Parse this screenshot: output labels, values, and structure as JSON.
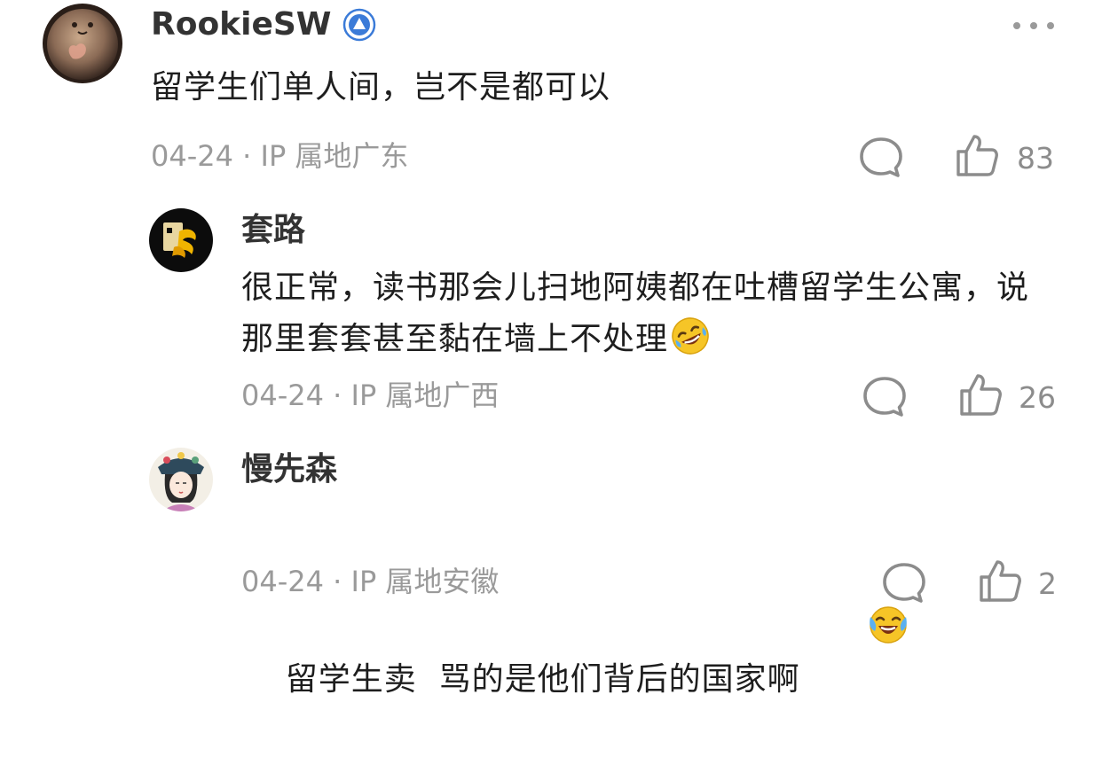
{
  "comments": [
    {
      "username": "RookieSW",
      "verified": true,
      "text": "留学生们单人间，岂不是都可以",
      "meta": "04-24 · IP 属地广东",
      "likes": "83"
    },
    {
      "username": "套路",
      "text": "很正常，读书那会儿扫地阿姨都在吐槽留学生公寓，说那里套套甚至黏在墙上不处理",
      "emoji": "rofl-emoji",
      "meta": "04-24 · IP 属地广西",
      "likes": "26"
    },
    {
      "username": "慢先森",
      "text": "留学生卖  骂的是他们背后的国家啊",
      "emoji": "laughing-crying-emoji",
      "meta": "04-24 · IP 属地安徽",
      "likes": "2"
    }
  ],
  "colors": {
    "meta_gray": "#9a9a9a",
    "icon_gray": "#8c8c8c",
    "badge_blue": "#3b7bd8"
  },
  "icons": {
    "more": "more-dots-icon",
    "reply": "comment-bubble-icon",
    "like": "thumbs-up-icon",
    "verified": "verified-badge-icon"
  }
}
